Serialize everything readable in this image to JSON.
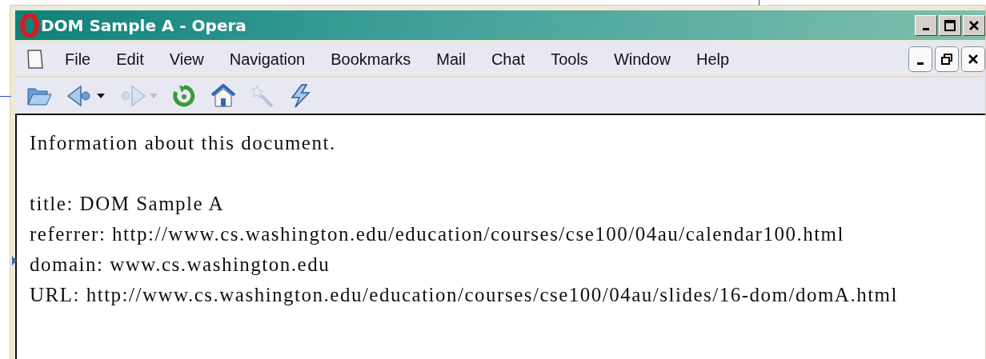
{
  "window": {
    "title": "DOM Sample A - Opera"
  },
  "menu": [
    "File",
    "Edit",
    "View",
    "Navigation",
    "Bookmarks",
    "Mail",
    "Chat",
    "Tools",
    "Window",
    "Help"
  ],
  "toolbar": [
    {
      "kind": "open",
      "disabled": false,
      "dropdown": false
    },
    {
      "kind": "back",
      "disabled": false,
      "dropdown": true
    },
    {
      "kind": "forward",
      "disabled": true,
      "dropdown": true
    },
    {
      "kind": "reload",
      "disabled": false,
      "dropdown": false
    },
    {
      "kind": "home",
      "disabled": false,
      "dropdown": false
    },
    {
      "kind": "wand",
      "disabled": true,
      "dropdown": false
    },
    {
      "kind": "bolt",
      "disabled": false,
      "dropdown": false
    }
  ],
  "document": {
    "heading": "Information about this document.",
    "lines": [
      "title: DOM Sample A",
      "referrer: http://www.cs.washington.edu/education/courses/cse100/04au/calendar100.html",
      "domain: www.cs.washington.edu",
      "URL: http://www.cs.washington.edu/education/courses/cse100/04au/slides/16-dom/domA.html"
    ]
  }
}
